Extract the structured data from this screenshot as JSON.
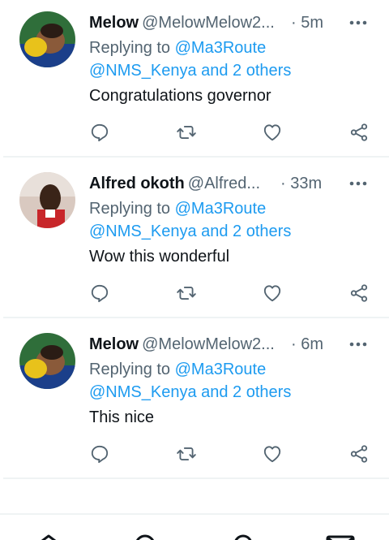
{
  "tweets": [
    {
      "display_name": "Melow",
      "handle": "@MelowMelow2...",
      "time": "· 5m",
      "replying_prefix": "Replying to",
      "replying_mention1": "@Ma3Route",
      "replying_rest": "@NMS_Kenya and 2 others",
      "text": "Congratulations governor"
    },
    {
      "display_name": "Alfred okoth",
      "handle": "@Alfred...",
      "time": "· 33m",
      "replying_prefix": "Replying to",
      "replying_mention1": "@Ma3Route",
      "replying_rest": "@NMS_Kenya and 2 others",
      "text": "Wow this wonderful"
    },
    {
      "display_name": "Melow",
      "handle": "@MelowMelow2...",
      "time": "· 6m",
      "replying_prefix": "Replying to",
      "replying_mention1": "@Ma3Route",
      "replying_rest": "@NMS_Kenya and 2 others",
      "text": "This nice"
    }
  ],
  "icons": {
    "more": "more-icon",
    "reply": "reply-icon",
    "retweet": "retweet-icon",
    "like": "heart-icon",
    "share": "share-icon",
    "nav": [
      "home-icon",
      "search-icon",
      "spaces-icon",
      "messages-icon"
    ]
  },
  "colors": {
    "text": "#0f1419",
    "secondary": "#536471",
    "link": "#1d9bf0",
    "divider": "#eff3f4"
  }
}
